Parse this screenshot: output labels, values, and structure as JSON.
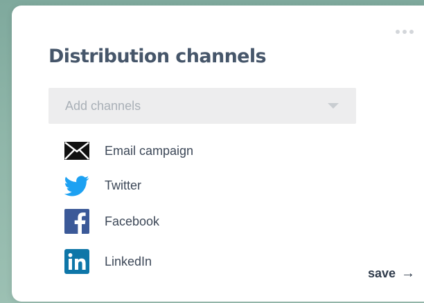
{
  "panel": {
    "title": "Distribution channels",
    "more_icon": "more-horizontal-icon"
  },
  "channel_select": {
    "placeholder": "Add channels",
    "caret_icon": "chevron-down-icon"
  },
  "channels": [
    {
      "label": "Email campaign",
      "icon": "envelope-icon",
      "color": "#111111"
    },
    {
      "label": "Twitter",
      "icon": "twitter-icon",
      "color": "#1da1f2"
    },
    {
      "label": "Facebook",
      "icon": "facebook-icon",
      "color": "#3b5998"
    },
    {
      "label": "LinkedIn",
      "icon": "linkedin-icon",
      "color": "#0e76a8"
    }
  ],
  "footer": {
    "save_label": "save",
    "save_arrow": "→"
  }
}
